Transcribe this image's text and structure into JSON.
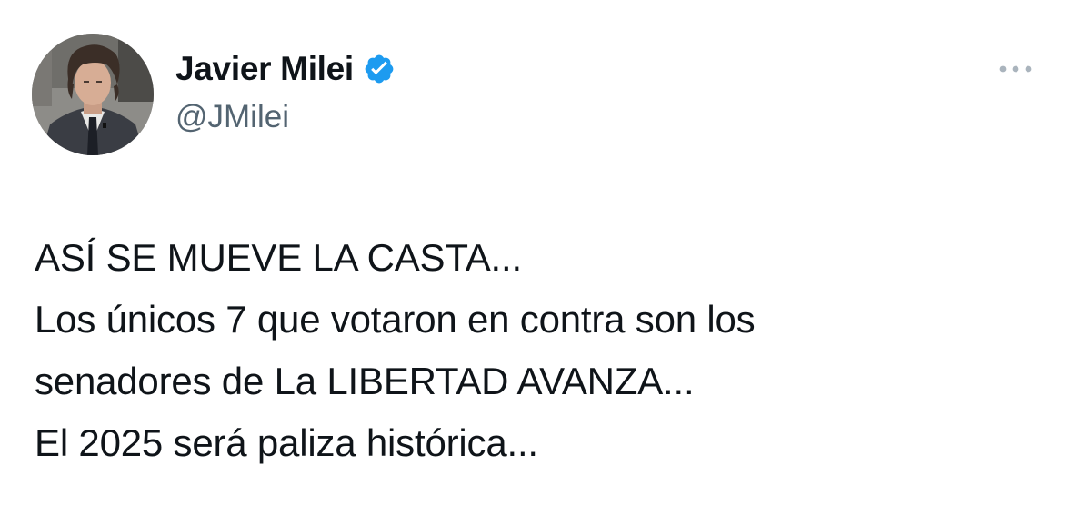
{
  "author": {
    "display_name": "Javier Milei",
    "handle": "@JMilei",
    "verified": true,
    "verified_color": "#1d9bf0",
    "avatar_icon": "profile-photo"
  },
  "menu": {
    "more_icon": "more-horizontal-icon"
  },
  "tweet": {
    "lines": [
      "ASÍ SE MUEVE LA CASTA...",
      "Los únicos 7 que votaron en contra son los",
      "senadores de La LIBERTAD AVANZA...",
      "El 2025 será paliza histórica..."
    ]
  }
}
